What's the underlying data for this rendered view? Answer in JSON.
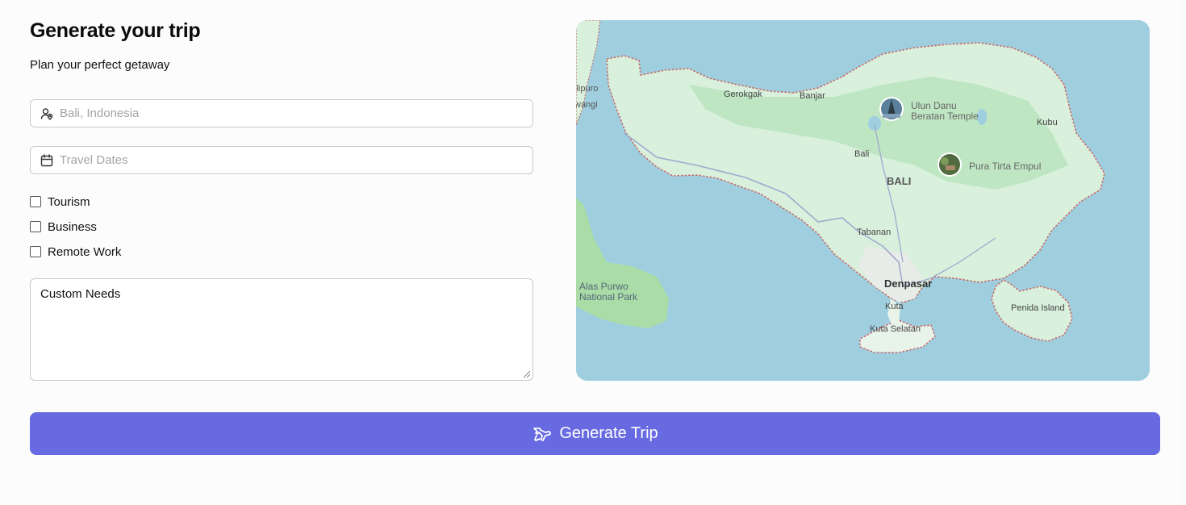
{
  "form": {
    "title": "Generate your trip",
    "subtitle": "Plan your perfect getaway",
    "destination_placeholder": "Bali, Indonesia",
    "dates_placeholder": "Travel Dates",
    "purposes": [
      {
        "label": "Tourism",
        "checked": false
      },
      {
        "label": "Business",
        "checked": false
      },
      {
        "label": "Remote Work",
        "checked": false
      }
    ],
    "custom_needs_placeholder": "Custom Needs",
    "generate_label": "Generate Trip"
  },
  "map": {
    "labels": {
      "ilipuro": "ilipuro",
      "wangi": "wangi",
      "gerokgak": "Gerokgak",
      "banjar": "Banjar",
      "ulun_danu_1": "Ulun Danu",
      "ulun_danu_2": "Beratan Temple",
      "kubu": "Kubu",
      "bali_small": "Bali",
      "bali_region": "BALI",
      "pura_tirta_empul": "Pura Tirta Empul",
      "tabanan": "Tabanan",
      "alas_purwo_1": "Alas Purwo",
      "alas_purwo_2": "National Park",
      "denpasar": "Denpasar",
      "kuta": "Kuta",
      "kuta_selatan": "Kuta Selatan",
      "penida_island": "Penida Island"
    },
    "colors": {
      "sea": "#9fcfdf",
      "land": "#d8f0dc",
      "park": "#a9dca6",
      "border": "#c96a6a",
      "road": "#a0aacf"
    }
  }
}
